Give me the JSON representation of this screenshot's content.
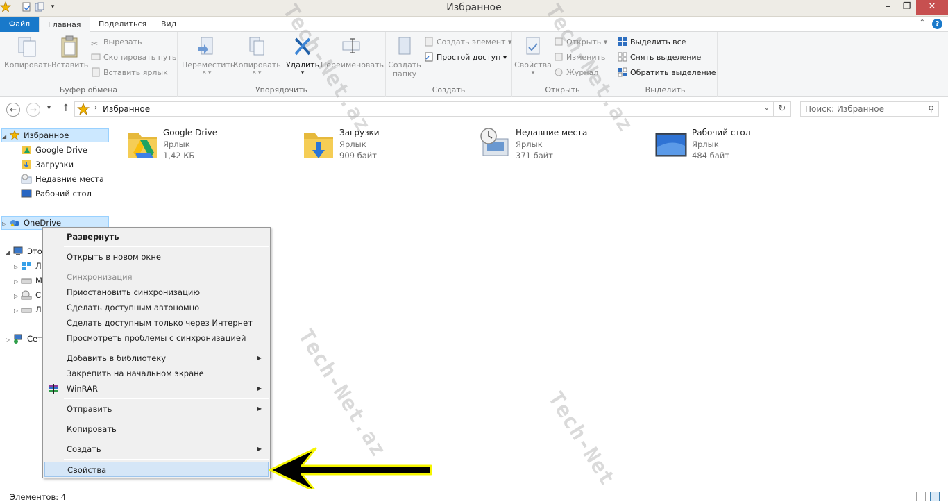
{
  "window": {
    "title": "Избранное"
  },
  "ribbon_tabs": {
    "file": "Файл",
    "home": "Главная",
    "share": "Поделиться",
    "view": "Вид"
  },
  "ribbon": {
    "clipboard": {
      "label": "Буфер обмена",
      "copy": "Копировать",
      "paste": "Вставить",
      "cut": "Вырезать",
      "copy_path": "Скопировать путь",
      "paste_shortcut": "Вставить ярлык"
    },
    "organize": {
      "label": "Упорядочить",
      "move_to": "Переместить",
      "move_to_sub": "в ▾",
      "copy_to": "Копировать",
      "copy_to_sub": "в ▾",
      "delete": "Удалить",
      "rename": "Переименовать"
    },
    "new": {
      "label": "Создать",
      "new_folder": "Создать",
      "new_folder_sub": "папку",
      "new_item": "Создать элемент ▾",
      "easy_access": "Простой доступ ▾"
    },
    "open": {
      "label": "Открыть",
      "properties": "Свойства",
      "open": "Открыть ▾",
      "edit": "Изменить",
      "history": "Журнал"
    },
    "select": {
      "label": "Выделить",
      "select_all": "Выделить все",
      "select_none": "Снять выделение",
      "invert": "Обратить выделение"
    }
  },
  "address": {
    "path": "Избранное",
    "search_placeholder": "Поиск: Избранное"
  },
  "nav": {
    "favorites": "Избранное",
    "google_drive": "Google Drive",
    "downloads": "Загрузки",
    "recent": "Недавние места",
    "desktop": "Рабочий стол",
    "onedrive": "OneDrive",
    "this_pc": "Этот",
    "pc_child1": "Ло",
    "pc_child2": "М",
    "pc_child3": "СI",
    "pc_child4": "Ло",
    "network": "Сет"
  },
  "files": [
    {
      "name": "Google Drive",
      "type": "Ярлык",
      "size": "1,42 КБ"
    },
    {
      "name": "Загрузки",
      "type": "Ярлык",
      "size": "909 байт"
    },
    {
      "name": "Недавние места",
      "type": "Ярлык",
      "size": "371 байт"
    },
    {
      "name": "Рабочий стол",
      "type": "Ярлык",
      "size": "484 байт"
    }
  ],
  "context_menu": {
    "expand": "Развернуть",
    "open_new_window": "Открыть в новом окне",
    "sync_header": "Синхронизация",
    "pause_sync": "Приостановить синхронизацию",
    "make_offline": "Сделать доступным автономно",
    "online_only": "Сделать доступным только через Интернет",
    "view_sync_problems": "Просмотреть проблемы с синхронизацией",
    "add_to_library": "Добавить в библиотеку",
    "pin_to_start": "Закрепить на начальном экране",
    "winrar": "WinRAR",
    "send_to": "Отправить",
    "copy": "Копировать",
    "create": "Создать",
    "properties": "Свойства"
  },
  "status": {
    "items_count": "Элементов: 4"
  },
  "watermark": "Tech-Net.az",
  "colors": {
    "file_tab": "#1979ca",
    "selection": "#cce8ff",
    "menu_hover": "#d5e6f7",
    "arrow_fill": "#000000",
    "arrow_outline": "#f5f500"
  }
}
